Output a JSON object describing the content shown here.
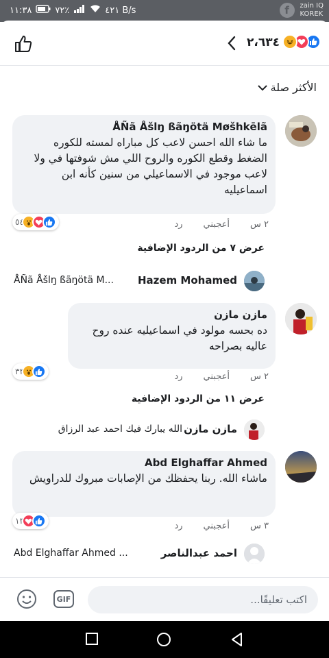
{
  "status_bar": {
    "time": "١١:٣٨",
    "battery": "٧٢٪",
    "speed": "٤٢١ B/s",
    "carrier_line1": "zain IQ",
    "carrier_line2": "KOREK"
  },
  "header": {
    "reaction_count": "٢،٦٣٤",
    "reactions": [
      "like",
      "love",
      "haha"
    ]
  },
  "sort_label": "الأكثر صلة",
  "comments": [
    {
      "author": "ÅÑã Åšlŋ ßãŋötä Møšhkēlã",
      "text": "ما شاء الله احسن لاعب كل مباراه لمسته للكوره الضغط وقطع الكوره والروح اللي مش شوفتها في ولا لاعب موجود في الاسماعيلي من سنين كأنه ابن اسماعيليه",
      "time": "٢ س",
      "like_label": "أعجبني",
      "reply_label": "رد",
      "reaction_count": "٥٤",
      "reactions": [
        "like",
        "love",
        "wow"
      ],
      "more_replies": "عرض ٧ من الردود الإضافية",
      "reply": {
        "author": "Hazem Mohamed",
        "preview": "ÅÑã Åšlŋ ßãŋötä M..."
      }
    },
    {
      "author": "مازن مازن",
      "text": "ده بحسه مولود في اسماعيليه عنده روح عاليه بصراحه",
      "time": "٢ س",
      "like_label": "أعجبني",
      "reply_label": "رد",
      "reaction_count": "٣٣",
      "reactions": [
        "like",
        "wow"
      ],
      "more_replies": "عرض ١١ من الردود الإضافية",
      "reply": {
        "author": "مازن مازن",
        "preview": "الله يبارك فيك احمد عبد الرزاق"
      }
    },
    {
      "author": "Abd Elghaffar Ahmed",
      "text": "ماشاء الله. ربنا يحفظك من الإصابات مبروك للدراويش",
      "time": "٣ س",
      "like_label": "أعجبني",
      "reply_label": "رد",
      "reaction_count": "١٣",
      "reactions": [
        "like",
        "love"
      ],
      "reply": {
        "author": "احمد عبدالناصر",
        "preview": "Abd Elghaffar Ahmed ..."
      }
    }
  ],
  "input": {
    "placeholder": "اكتب تعليقًا...",
    "gif_label": "GIF"
  },
  "colors": {
    "facebook_blue": "#1877f2",
    "love_red": "#f33e58",
    "reaction_yellow": "#f7b125",
    "bubble_gray": "#f0f2f5",
    "meta_gray": "#65676b"
  }
}
